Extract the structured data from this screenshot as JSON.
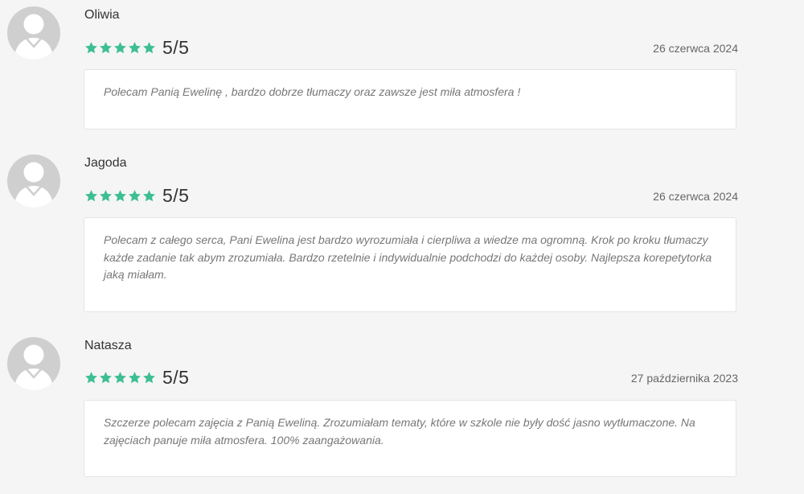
{
  "colors": {
    "star": "#3dbf91",
    "background": "#f5f5f5",
    "card": "#ffffff",
    "avatar": "#cfcfcf"
  },
  "reviews": [
    {
      "author": "Oliwia",
      "rating": 5,
      "score": "5/5",
      "date": "26 czerwca 2024",
      "text": "Polecam Panią Ewelinę , bardzo dobrze tłumaczy oraz zawsze jest miła atmosfera !"
    },
    {
      "author": "Jagoda",
      "rating": 5,
      "score": "5/5",
      "date": "26 czerwca 2024",
      "text": "Polecam z całego serca, Pani Ewelina jest bardzo wyrozumiała i cierpliwa a wiedze ma ogromną. Krok po kroku tłumaczy każde zadanie tak abym zrozumiała. Bardzo rzetelnie i indywidualnie podchodzi do każdej osoby. Najlepsza korepetytorka jaką miałam."
    },
    {
      "author": "Natasza",
      "rating": 5,
      "score": "5/5",
      "date": "27 października 2023",
      "text": "Szczerze polecam zajęcia z Panią Eweliną. Zrozumiałam tematy, które w szkole nie były dość jasno wytłumaczone. Na zajęciach panuje miła atmosfera. 100% zaangażowania."
    }
  ]
}
